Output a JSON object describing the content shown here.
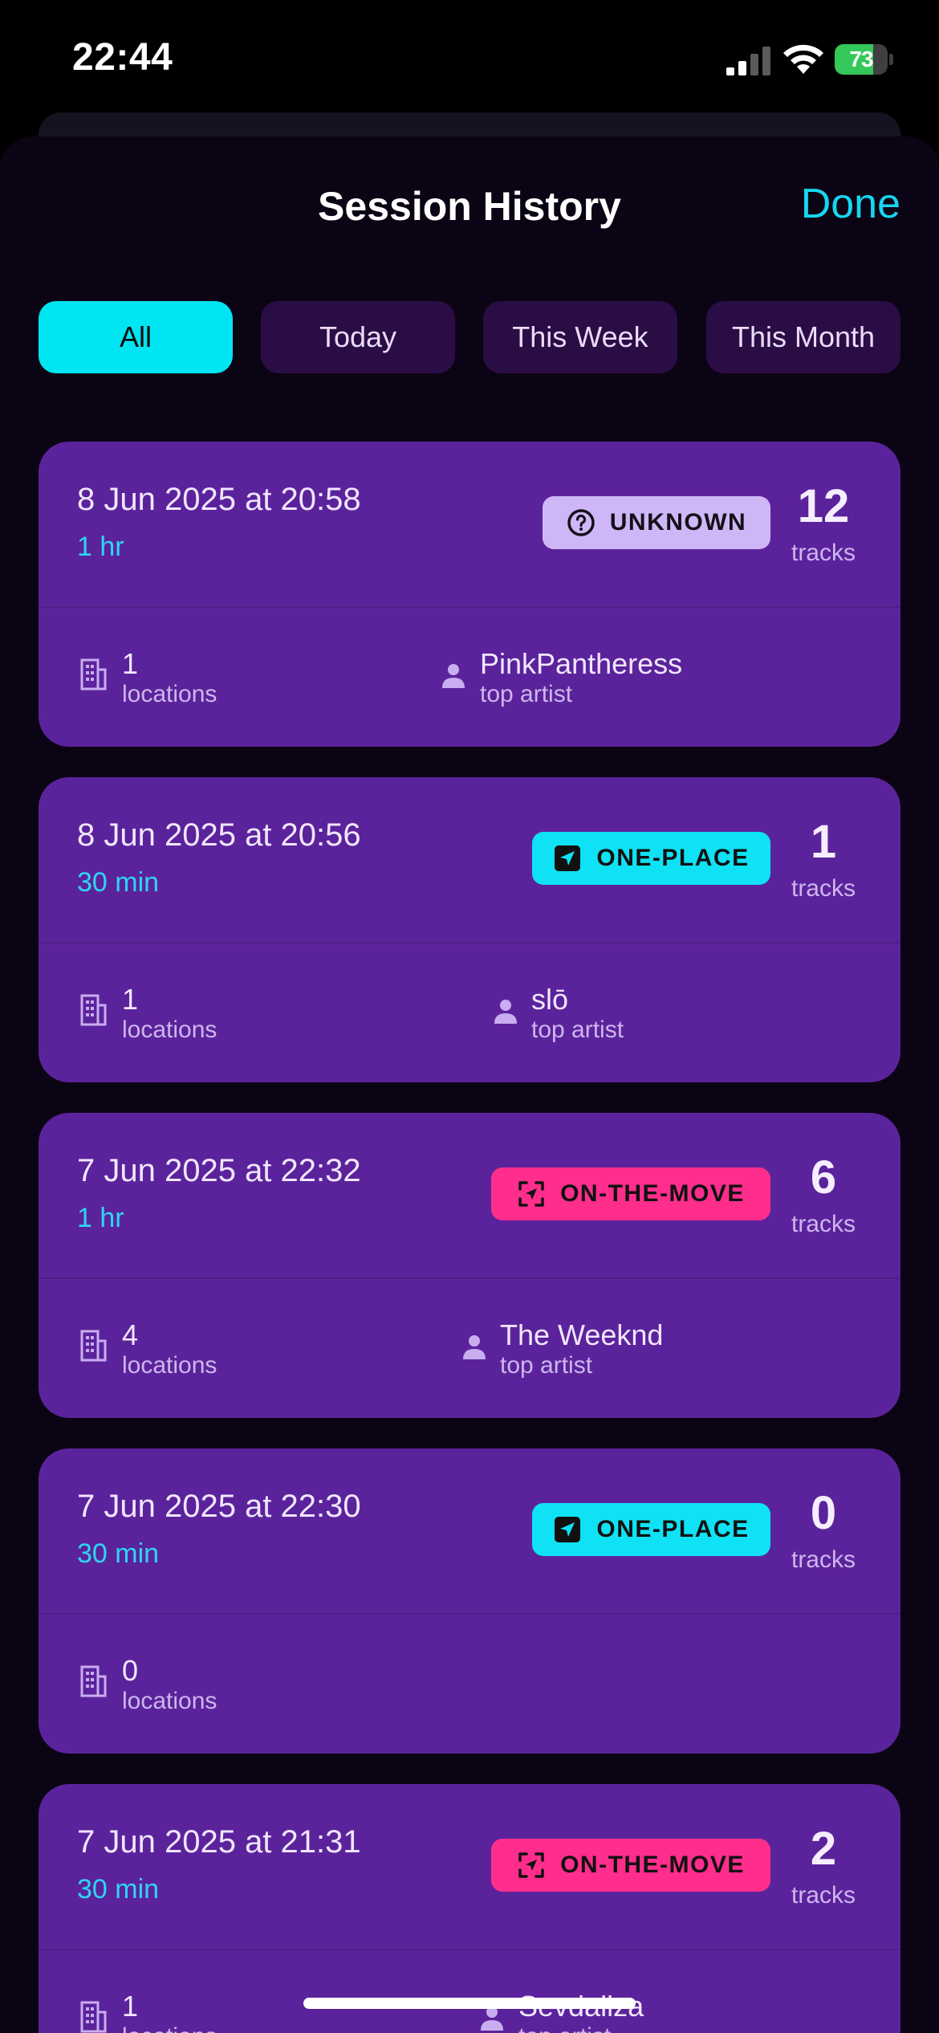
{
  "status_bar": {
    "time": "22:44",
    "battery": "73",
    "battery_level": 0.73
  },
  "header": {
    "title": "Session History",
    "done_label": "Done"
  },
  "filters": [
    {
      "label": "All",
      "active": true
    },
    {
      "label": "Today",
      "active": false
    },
    {
      "label": "This Week",
      "active": false
    },
    {
      "label": "This Month",
      "active": false
    }
  ],
  "sessions": [
    {
      "date": "8 Jun 2025 at 20:58",
      "duration": "1 hr",
      "tag": "UNKNOWN",
      "tag_kind": "unknown",
      "tracks": "12",
      "tracks_label": "tracks",
      "locations": "1",
      "locations_label": "locations",
      "top_artist": "PinkPantheress",
      "top_artist_label": "top artist"
    },
    {
      "date": "8 Jun 2025 at 20:56",
      "duration": "30 min",
      "tag": "ONE-PLACE",
      "tag_kind": "oneplace",
      "tracks": "1",
      "tracks_label": "tracks",
      "locations": "1",
      "locations_label": "locations",
      "top_artist": "slō",
      "top_artist_label": "top artist"
    },
    {
      "date": "7 Jun 2025 at 22:32",
      "duration": "1 hr",
      "tag": "ON-THE-MOVE",
      "tag_kind": "onthemove",
      "tracks": "6",
      "tracks_label": "tracks",
      "locations": "4",
      "locations_label": "locations",
      "top_artist": "The Weeknd",
      "top_artist_label": "top artist"
    },
    {
      "date": "7 Jun 2025 at 22:30",
      "duration": "30 min",
      "tag": "ONE-PLACE",
      "tag_kind": "oneplace",
      "tracks": "0",
      "tracks_label": "tracks",
      "locations": "0",
      "locations_label": "locations"
    },
    {
      "date": "7 Jun 2025 at 21:31",
      "duration": "30 min",
      "tag": "ON-THE-MOVE",
      "tag_kind": "onthemove",
      "tracks": "2",
      "tracks_label": "tracks",
      "locations": "1",
      "locations_label": "locations",
      "top_artist": "Sevdaliza",
      "top_artist_label": "top artist"
    }
  ],
  "icons": {
    "unknown": "question-circle-icon",
    "oneplace": "location-arrow-icon",
    "onthemove": "scan-frame-icon",
    "locations": "building-icon",
    "artist": "person-icon"
  },
  "colors": {
    "background": "#0b0414",
    "card": "#5b239b",
    "accent": "#00e5f2",
    "tag_unknown": "#cfb7f7",
    "tag_oneplace": "#0fe2f4",
    "tag_onthemove": "#ff2d8c",
    "duration": "#2fd4f2"
  }
}
